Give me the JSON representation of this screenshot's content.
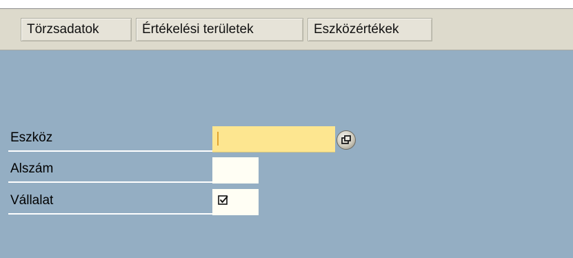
{
  "toolbar": {
    "buttons": [
      {
        "label": "Törzsadatok"
      },
      {
        "label": "Értékelési területek"
      },
      {
        "label": "Eszközértékek"
      }
    ]
  },
  "form": {
    "fields": [
      {
        "label": "Eszköz",
        "value": ""
      },
      {
        "label": "Alszám",
        "value": ""
      },
      {
        "label": "Vállalat",
        "value": ""
      }
    ],
    "help_icon": "possible-entries-icon",
    "checkbox_icon": "checkbox-checked-icon"
  },
  "colors": {
    "toolbar_bg": "#dddacc",
    "main_bg": "#94aec3",
    "required_field_bg": "#fde690",
    "input_bg": "#fffef4"
  }
}
